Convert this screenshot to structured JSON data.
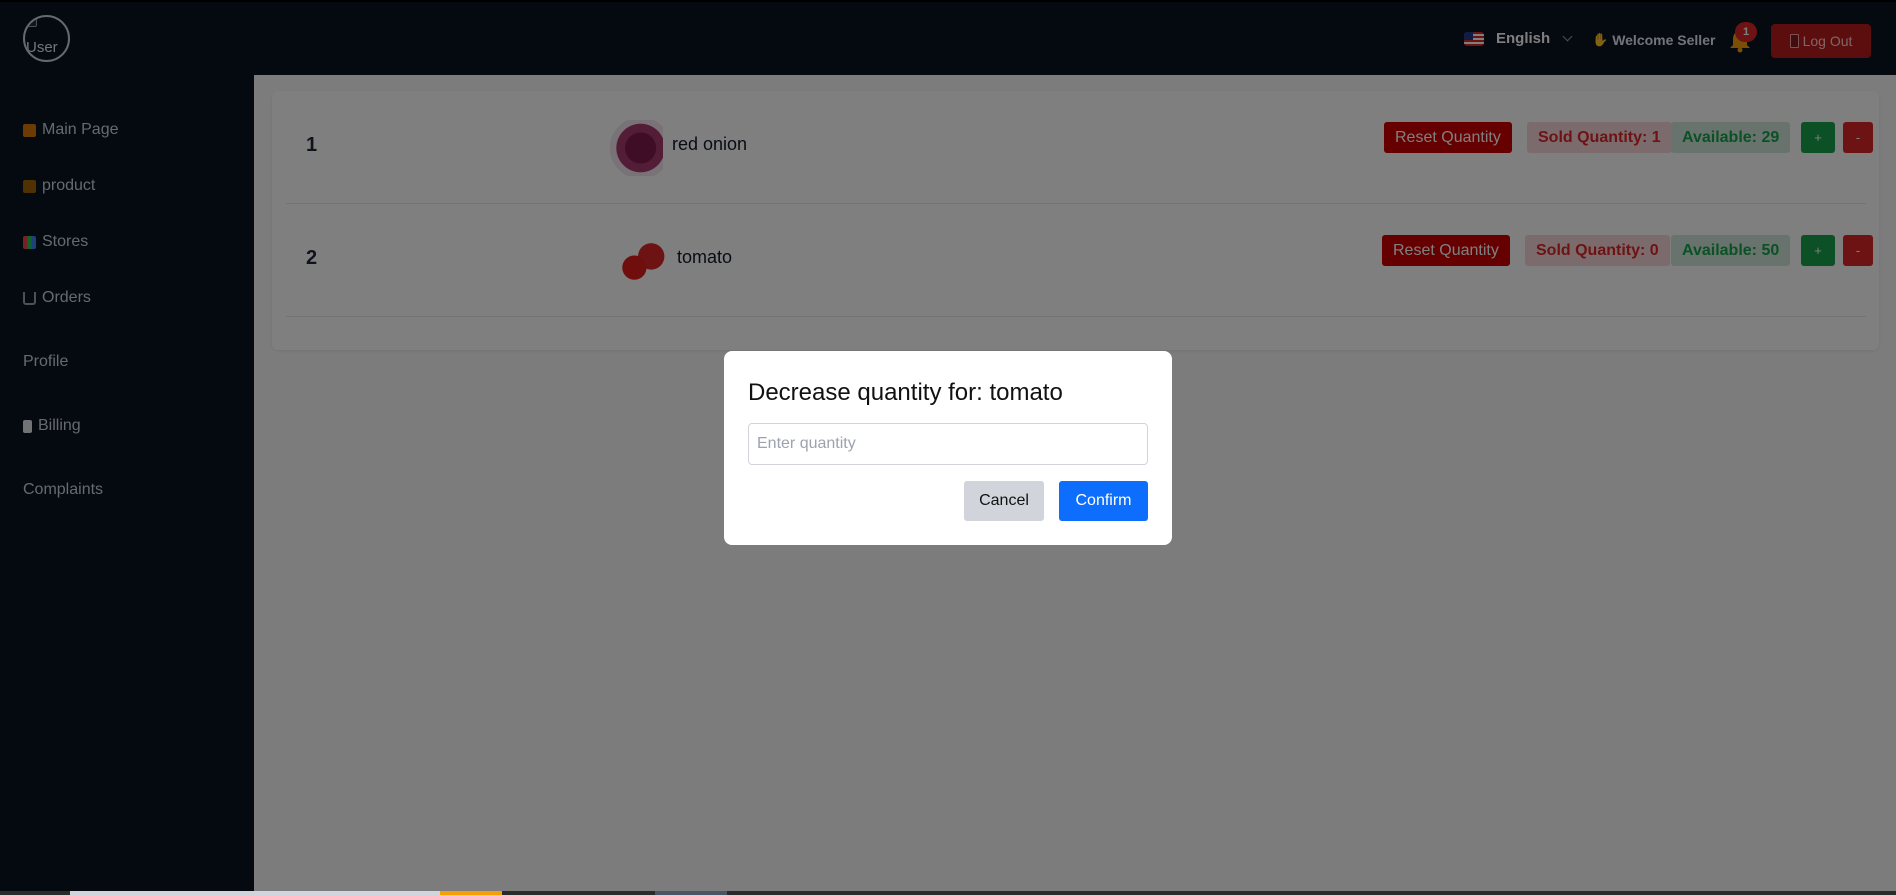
{
  "header": {
    "avatar_alt": "User",
    "language": "English",
    "welcome": "Welcome Seller",
    "notification_count": "1",
    "logout_label": "Log Out"
  },
  "sidebar": {
    "items": [
      {
        "label": "Main Page",
        "icon": "home-icon"
      },
      {
        "label": "product",
        "icon": "box-icon"
      },
      {
        "label": "Stores",
        "icon": "store-icon"
      },
      {
        "label": "Orders",
        "icon": "cart-icon"
      },
      {
        "label": "Profile",
        "icon": ""
      },
      {
        "label": "Billing",
        "icon": "receipt-icon"
      },
      {
        "label": "Complaints",
        "icon": ""
      }
    ]
  },
  "products": [
    {
      "index": "1",
      "name": "red onion",
      "reset_label": "Reset Quantity",
      "sold": "Sold Quantity: 1",
      "available": "Available: 29",
      "plus": "+",
      "minus": "-"
    },
    {
      "index": "2",
      "name": "tomato",
      "reset_label": "Reset Quantity",
      "sold": "Sold Quantity: 0",
      "available": "Available: 50",
      "plus": "+",
      "minus": "-"
    }
  ],
  "modal": {
    "title": "Decrease quantity for: tomato",
    "input_placeholder": "Enter quantity",
    "cancel_label": "Cancel",
    "confirm_label": "Confirm"
  },
  "colors": {
    "nav_bg": "#0b1220",
    "danger": "#cc0000",
    "success": "#16a34a",
    "primary": "#0d6efd"
  }
}
